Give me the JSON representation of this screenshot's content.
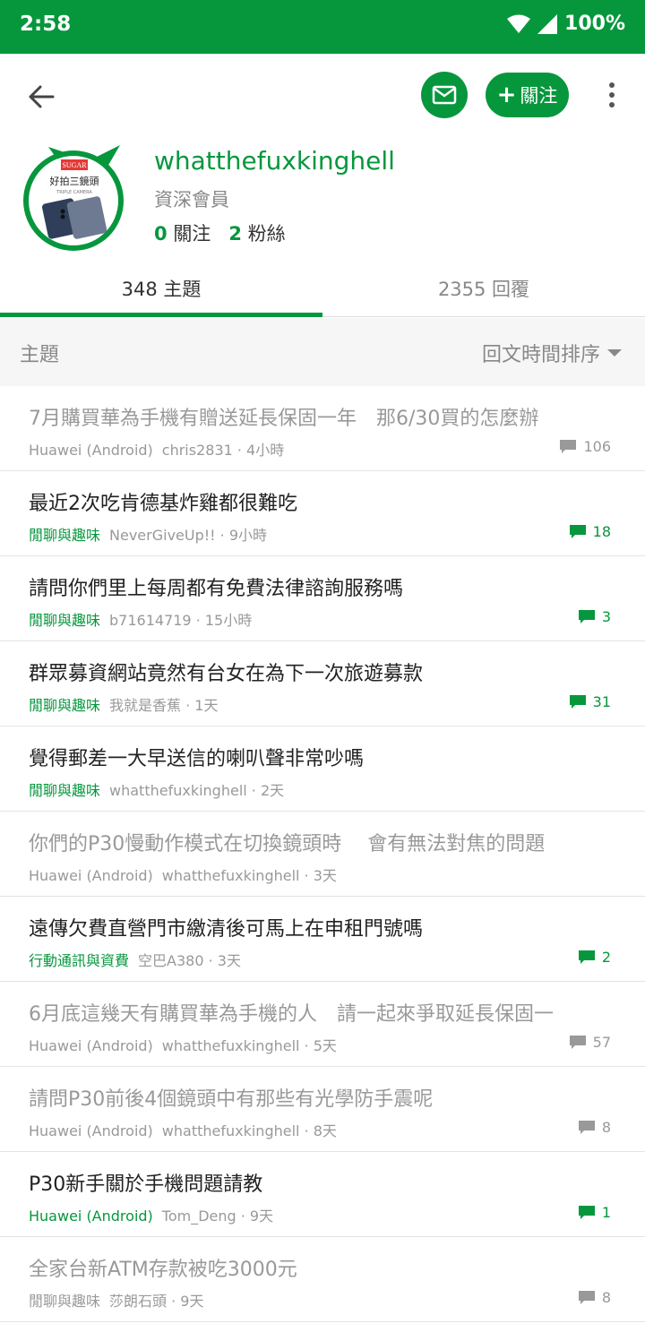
{
  "status": {
    "time": "2:58",
    "battery": "100%"
  },
  "profile": {
    "avatar_text_brand": "SUGAR",
    "avatar_text_main": "好拍三鏡頭",
    "avatar_text_sub": "TRIPLE CAMERA",
    "username": "whatthefuxkinghell",
    "rank": "資深會員",
    "following_count": "0",
    "following_label": "關注",
    "followers_count": "2",
    "followers_label": "粉絲",
    "follow_button": "關注",
    "accent_color": "#06973d"
  },
  "tabs": [
    {
      "label": "348 主題"
    },
    {
      "label": "2355 回覆"
    }
  ],
  "filter": {
    "label": "主題",
    "sort": "回文時間排序"
  },
  "topics": [
    {
      "title": "7月購買華為手機有贈送延長保固一年　那6/30買的怎麼辦",
      "forum": "Huawei (Android)",
      "meta": "chris2831 · 4小時",
      "replies": "106",
      "read": true
    },
    {
      "title": "最近2次吃肯德基炸雞都很難吃",
      "forum": "閒聊與趣味",
      "meta": "NeverGiveUp!! · 9小時",
      "replies": "18",
      "read": false
    },
    {
      "title": "請問你們里上每周都有免費法律諮詢服務嗎",
      "forum": "閒聊與趣味",
      "meta": "b71614719 · 15小時",
      "replies": "3",
      "read": false
    },
    {
      "title": "群眾募資網站竟然有台女在為下一次旅遊募款",
      "forum": "閒聊與趣味",
      "meta": "我就是香蕉 · 1天",
      "replies": "31",
      "read": false
    },
    {
      "title": "覺得郵差一大早送信的喇叭聲非常吵嗎",
      "forum": "閒聊與趣味",
      "meta": "whatthefuxkinghell · 2天",
      "replies": "",
      "read": false
    },
    {
      "title": "你們的P30慢動作模式在切換鏡頭時　 會有無法對焦的問題",
      "forum": "Huawei (Android)",
      "meta": "whatthefuxkinghell · 3天",
      "replies": "",
      "read": true
    },
    {
      "title": "遠傳欠費直營門市繳清後可馬上在申租門號嗎",
      "forum": "行動通訊與資費",
      "meta": "空巴A380 · 3天",
      "replies": "2",
      "read": false
    },
    {
      "title": "6月底這幾天有購買華為手機的人　請一起來爭取延長保固一",
      "forum": "Huawei (Android)",
      "meta": "whatthefuxkinghell · 5天",
      "replies": "57",
      "read": true
    },
    {
      "title": "請問P30前後4個鏡頭中有那些有光學防手震呢",
      "forum": "Huawei (Android)",
      "meta": "whatthefuxkinghell · 8天",
      "replies": "8",
      "read": true
    },
    {
      "title": "P30新手關於手機問題請教",
      "forum": "Huawei (Android)",
      "meta": "Tom_Deng · 9天",
      "replies": "1",
      "read": false
    },
    {
      "title": "全家台新ATM存款被吃3000元",
      "forum": "閒聊與趣味",
      "meta": "莎朗石頭 · 9天",
      "replies": "8",
      "read": true
    }
  ]
}
